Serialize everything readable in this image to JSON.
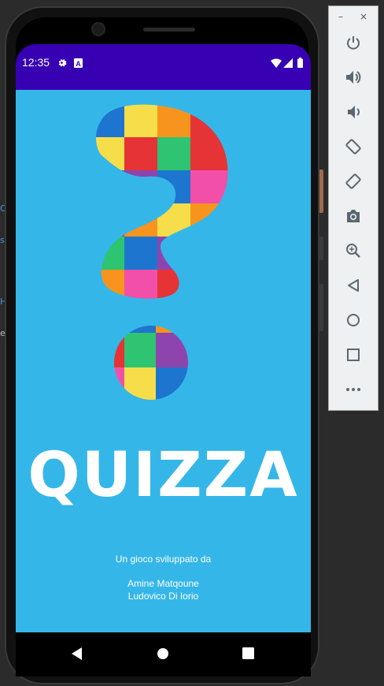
{
  "sidebar_fragments": [
    "O",
    "s",
    "H",
    "e"
  ],
  "status_bar": {
    "time": "12:35",
    "icons": [
      "gear-icon",
      "text-a-icon",
      "wifi-icon",
      "signal-icon",
      "battery-icon"
    ]
  },
  "app": {
    "title": "QUIZZA",
    "credit_label": "Un gioco sviluppato da",
    "authors": [
      "Amine Matqoune",
      "Ludovico Di Iorio"
    ],
    "logo": "colorful-question-mark-icon"
  },
  "navigation_bar": {
    "buttons": [
      "back-icon",
      "home-icon",
      "recents-icon"
    ]
  },
  "emulator_toolbar": {
    "window_controls": [
      "minimize-icon",
      "close-icon"
    ],
    "minimize_glyph": "–",
    "close_glyph": "×",
    "buttons": [
      "power-icon",
      "volume-up-icon",
      "volume-down-icon",
      "rotate-left-icon",
      "rotate-right-icon",
      "camera-icon",
      "zoom-icon",
      "back-icon",
      "home-icon",
      "overview-icon",
      "more-icon"
    ]
  },
  "colors": {
    "status_bar": "#3700b3",
    "app_background": "#35b6e8",
    "logo_tiles": [
      "#f5de4a",
      "#e63336",
      "#2ec471",
      "#1d75cf",
      "#f7941d",
      "#f24fa8",
      "#8e44ad",
      "#ffd700"
    ]
  }
}
